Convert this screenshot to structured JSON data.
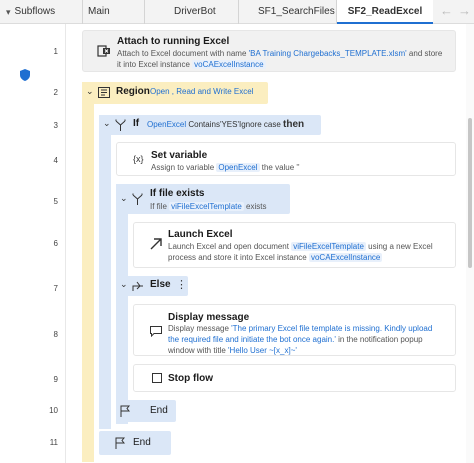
{
  "tabs": {
    "subflows_label": "Subflows",
    "items": [
      "Main",
      "DriverBot",
      "SF1_SearchFiles",
      "SF2_ReadExcel"
    ],
    "prev_arrow": "←",
    "next_arrow": "→"
  },
  "line_numbers": [
    "1",
    "2",
    "3",
    "4",
    "5",
    "6",
    "7",
    "8",
    "9",
    "10",
    "11"
  ],
  "steps": {
    "attach": {
      "title": "Attach to running Excel",
      "desc_a": "Attach to Excel document with name ",
      "doc_name": "'BA Training Chargebacks_TEMPLATE.xlsm'",
      "desc_b": " and store",
      "desc_c": "it into Excel instance ",
      "var": "voCAExcelInstance"
    },
    "region": {
      "label": "Region",
      "name": "Open , Read and Write Excel"
    },
    "if": {
      "label": "If",
      "var": "OpenExcel",
      "cond": " Contains",
      "value": "'YES'",
      "opt": "Ignore case ",
      "then": "then"
    },
    "setvar": {
      "title": "Set variable",
      "desc_a": "Assign to variable ",
      "var": "OpenExcel",
      "desc_b": " the value ''"
    },
    "iffile": {
      "label": "If file exists",
      "desc_a": "If file ",
      "var": "viFileExcelTemplate",
      "desc_b": " exists"
    },
    "launch": {
      "title": "Launch Excel",
      "desc_a": "Launch Excel and open document ",
      "var1": "viFileExcelTemplate",
      "desc_b": " using a new Excel",
      "desc_c": "process and store it into Excel instance ",
      "var2": "voCAExcelInstance"
    },
    "else": {
      "label": "Else",
      "more": "⋮"
    },
    "display": {
      "title": "Display message",
      "desc_a": "Display message ",
      "msg1": "'The primary Excel file template is missing.  Kindly upload",
      "msg2": "the required file and initiate the bot once again.'",
      "desc_b": " in the notification popup",
      "desc_c": "window with title ",
      "title_val": "'Hello User ~[x_x]~'"
    },
    "stopflow": {
      "title": "Stop flow"
    },
    "end_inner": "End",
    "end_outer": "End"
  },
  "colors": {
    "accent": "#1f6fd1",
    "region_bg": "#fbeec0",
    "if_bg": "#dbe7f7"
  }
}
